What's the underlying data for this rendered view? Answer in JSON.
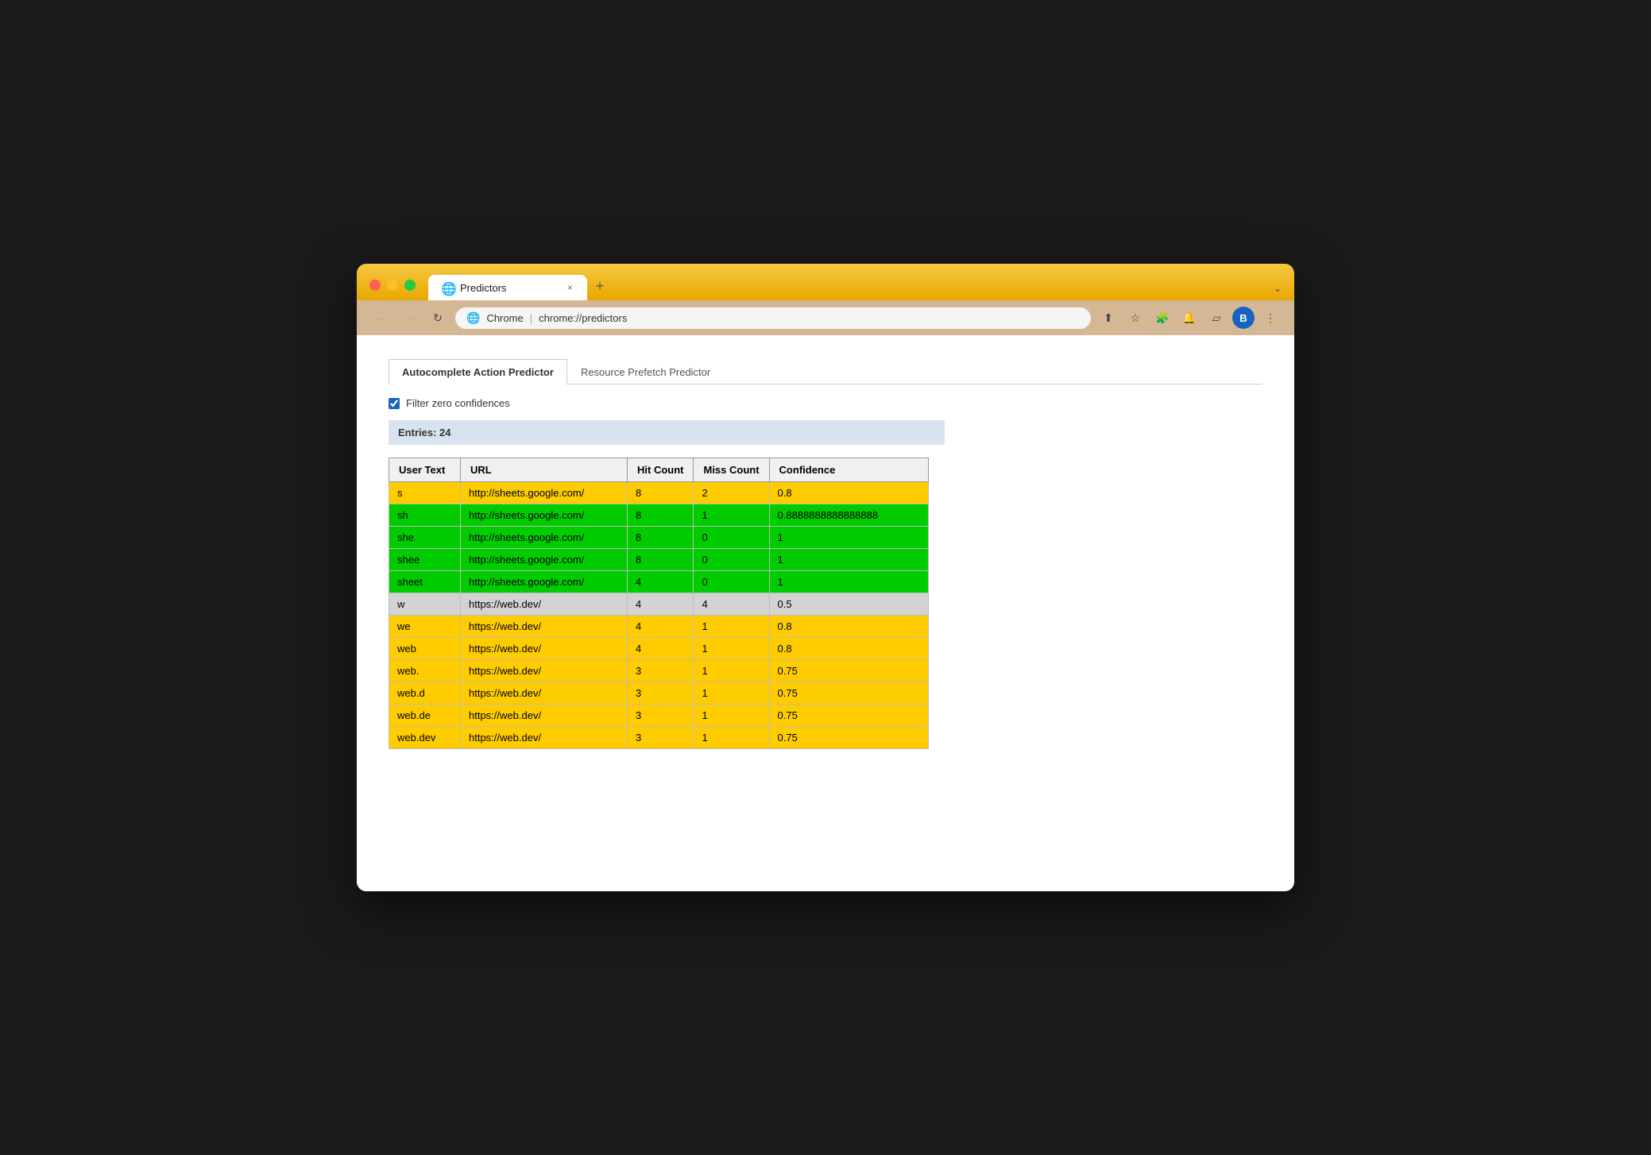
{
  "browser": {
    "tab_title": "Predictors",
    "tab_close": "×",
    "tab_new": "+",
    "chevron": "⌄",
    "address_icon": "🌐",
    "chrome_label": "Chrome",
    "separator": "|",
    "address": "chrome://predictors",
    "nav_back": "←",
    "nav_forward": "→",
    "nav_reload": "↻",
    "toolbar_icons": [
      "⬆",
      "★",
      "🧩",
      "🔔",
      "▱",
      "B",
      "⋮"
    ]
  },
  "page": {
    "tabs": [
      {
        "label": "Autocomplete Action Predictor",
        "active": true
      },
      {
        "label": "Resource Prefetch Predictor",
        "active": false
      }
    ],
    "filter_label": "Filter zero confidences",
    "filter_checked": true,
    "entries_label": "Entries: 24",
    "table": {
      "headers": [
        "User Text",
        "URL",
        "Hit Count",
        "Miss Count",
        "Confidence"
      ],
      "rows": [
        {
          "user_text": "s",
          "url": "http://sheets.google.com/",
          "hit_count": "8",
          "miss_count": "2",
          "confidence": "0.8",
          "color": "yellow"
        },
        {
          "user_text": "sh",
          "url": "http://sheets.google.com/",
          "hit_count": "8",
          "miss_count": "1",
          "confidence": "0.8888888888888888",
          "color": "green"
        },
        {
          "user_text": "she",
          "url": "http://sheets.google.com/",
          "hit_count": "8",
          "miss_count": "0",
          "confidence": "1",
          "color": "green"
        },
        {
          "user_text": "shee",
          "url": "http://sheets.google.com/",
          "hit_count": "8",
          "miss_count": "0",
          "confidence": "1",
          "color": "green"
        },
        {
          "user_text": "sheet",
          "url": "http://sheets.google.com/",
          "hit_count": "4",
          "miss_count": "0",
          "confidence": "1",
          "color": "green"
        },
        {
          "user_text": "w",
          "url": "https://web.dev/",
          "hit_count": "4",
          "miss_count": "4",
          "confidence": "0.5",
          "color": "gray"
        },
        {
          "user_text": "we",
          "url": "https://web.dev/",
          "hit_count": "4",
          "miss_count": "1",
          "confidence": "0.8",
          "color": "yellow"
        },
        {
          "user_text": "web",
          "url": "https://web.dev/",
          "hit_count": "4",
          "miss_count": "1",
          "confidence": "0.8",
          "color": "yellow"
        },
        {
          "user_text": "web.",
          "url": "https://web.dev/",
          "hit_count": "3",
          "miss_count": "1",
          "confidence": "0.75",
          "color": "yellow"
        },
        {
          "user_text": "web.d",
          "url": "https://web.dev/",
          "hit_count": "3",
          "miss_count": "1",
          "confidence": "0.75",
          "color": "yellow"
        },
        {
          "user_text": "web.de",
          "url": "https://web.dev/",
          "hit_count": "3",
          "miss_count": "1",
          "confidence": "0.75",
          "color": "yellow"
        },
        {
          "user_text": "web.dev",
          "url": "https://web.dev/",
          "hit_count": "3",
          "miss_count": "1",
          "confidence": "0.75",
          "color": "yellow"
        }
      ]
    }
  }
}
